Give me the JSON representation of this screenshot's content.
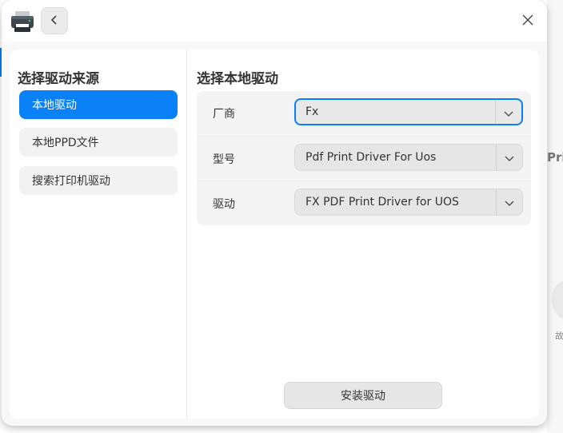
{
  "background": {
    "partial_text": "Pri",
    "partial_small": "故"
  },
  "titlebar": {
    "app_icon": "printer-icon",
    "back_icon": "chevron-left-icon",
    "close_icon": "close-icon"
  },
  "left": {
    "title": "选择驱动来源",
    "items": [
      {
        "label": "本地驱动",
        "active": true
      },
      {
        "label": "本地PPD文件",
        "active": false
      },
      {
        "label": "搜索打印机驱动",
        "active": false
      }
    ]
  },
  "right": {
    "title": "选择本地驱动",
    "fields": [
      {
        "label": "厂商",
        "value": "Fx"
      },
      {
        "label": "型号",
        "value": "Pdf Print Driver For Uos"
      },
      {
        "label": "驱动",
        "value": "FX PDF Print Driver for UOS"
      }
    ],
    "install_label": "安装驱动"
  },
  "colors": {
    "accent": "#0a81f6",
    "focus_border": "#0a7ef5"
  }
}
